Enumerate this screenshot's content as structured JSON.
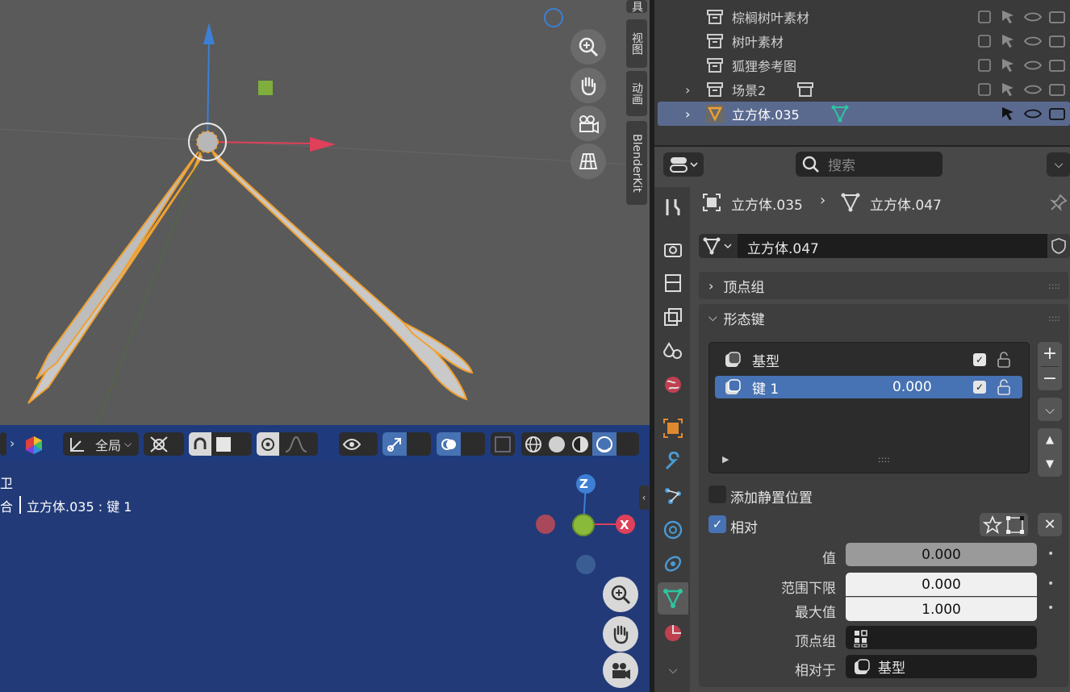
{
  "viewport_tabs": {
    "tab_tool": "具",
    "tab_view": "视图",
    "tab_anim": "动画",
    "tab_blenderkit": "BlenderKit"
  },
  "header": {
    "global_label": "全局"
  },
  "status": {
    "line1": "卫",
    "line2_prefix": "合",
    "line2": "立方体.035 : 键 1"
  },
  "gizmo": {
    "z": "Z",
    "x": "X"
  },
  "outliner": {
    "rows": [
      {
        "label": "棕榈树叶素材"
      },
      {
        "label": "树叶素材"
      },
      {
        "label": "狐狸参考图"
      },
      {
        "label": "场景2"
      },
      {
        "label": "立方体.035"
      }
    ]
  },
  "properties": {
    "search_placeholder": "搜索",
    "breadcrumb_object": "立方体.035",
    "breadcrumb_mesh": "立方体.047",
    "mesh_name": "立方体.047",
    "panel_vertex_groups": "顶点组",
    "panel_shape_keys": "形态键",
    "shape_keys": [
      {
        "name": "基型",
        "value": ""
      },
      {
        "name": "键 1",
        "value": "0.000"
      }
    ],
    "add_rest_position": "添加静置位置",
    "relative": "相对",
    "value_label": "值",
    "value": "0.000",
    "range_min_label": "范围下限",
    "range_min": "0.000",
    "max_label": "最大值",
    "max": "1.000",
    "vertex_group_label": "顶点组",
    "relative_to_label": "相对于",
    "relative_to": "基型"
  },
  "colors": {
    "accent": "#4772b3",
    "selection_orange": "#f0a030",
    "axis_red": "#e0405a",
    "axis_blue": "#3d7fd4",
    "axis_green": "#8aba3a"
  }
}
